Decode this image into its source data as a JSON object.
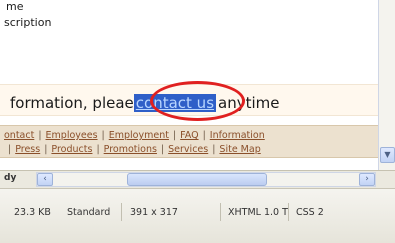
{
  "document": {
    "line1": "me",
    "line2": "scription",
    "body_prefix": "formation, plea",
    "body_partial": "e ",
    "link_text": "contact us",
    "body_suffix": "anytime"
  },
  "nav": {
    "row1": [
      "ontact",
      "Employees",
      "Employment",
      "FAQ",
      "Information"
    ],
    "row2": [
      "Press",
      "Products",
      "Promotions",
      "Services",
      "Site Map"
    ]
  },
  "tag_selector": {
    "label": "dy"
  },
  "status": {
    "file_size": "23.3 KB",
    "connection": "Standard",
    "dimensions": "391 x 317",
    "doctype": "XHTML 1.0 T",
    "css": "CSS 2"
  },
  "colors": {
    "highlight_ring": "#e02020",
    "selection": "#2f5fc8",
    "nav_background": "#ece1cf"
  }
}
